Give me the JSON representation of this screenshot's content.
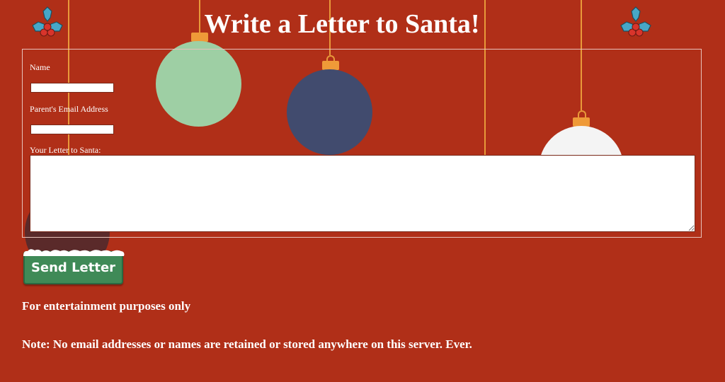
{
  "page": {
    "title": "Write a Letter to Santa!"
  },
  "form": {
    "name_label": "Name",
    "name_value": "",
    "email_label": "Parent's Email Address",
    "email_value": "",
    "letter_label": "Your Letter to Santa:",
    "letter_value": "",
    "submit_label": "Send Letter"
  },
  "footer": {
    "disclaimer": "For entertainment purposes only",
    "privacy_note": "Note: No email addresses or names are retained or stored anywhere on this server. Ever."
  },
  "decor": {
    "icons": [
      "holly-icon",
      "ornament-icon"
    ],
    "colors": {
      "background": "#b02f18",
      "ornament_green": "#9ecfa4",
      "ornament_navy": "#414b6e",
      "ornament_white": "#f4f4f4",
      "ornament_maroon": "#5a2a2a",
      "string": "#e89a3a",
      "button_green": "#3f8a57"
    }
  }
}
